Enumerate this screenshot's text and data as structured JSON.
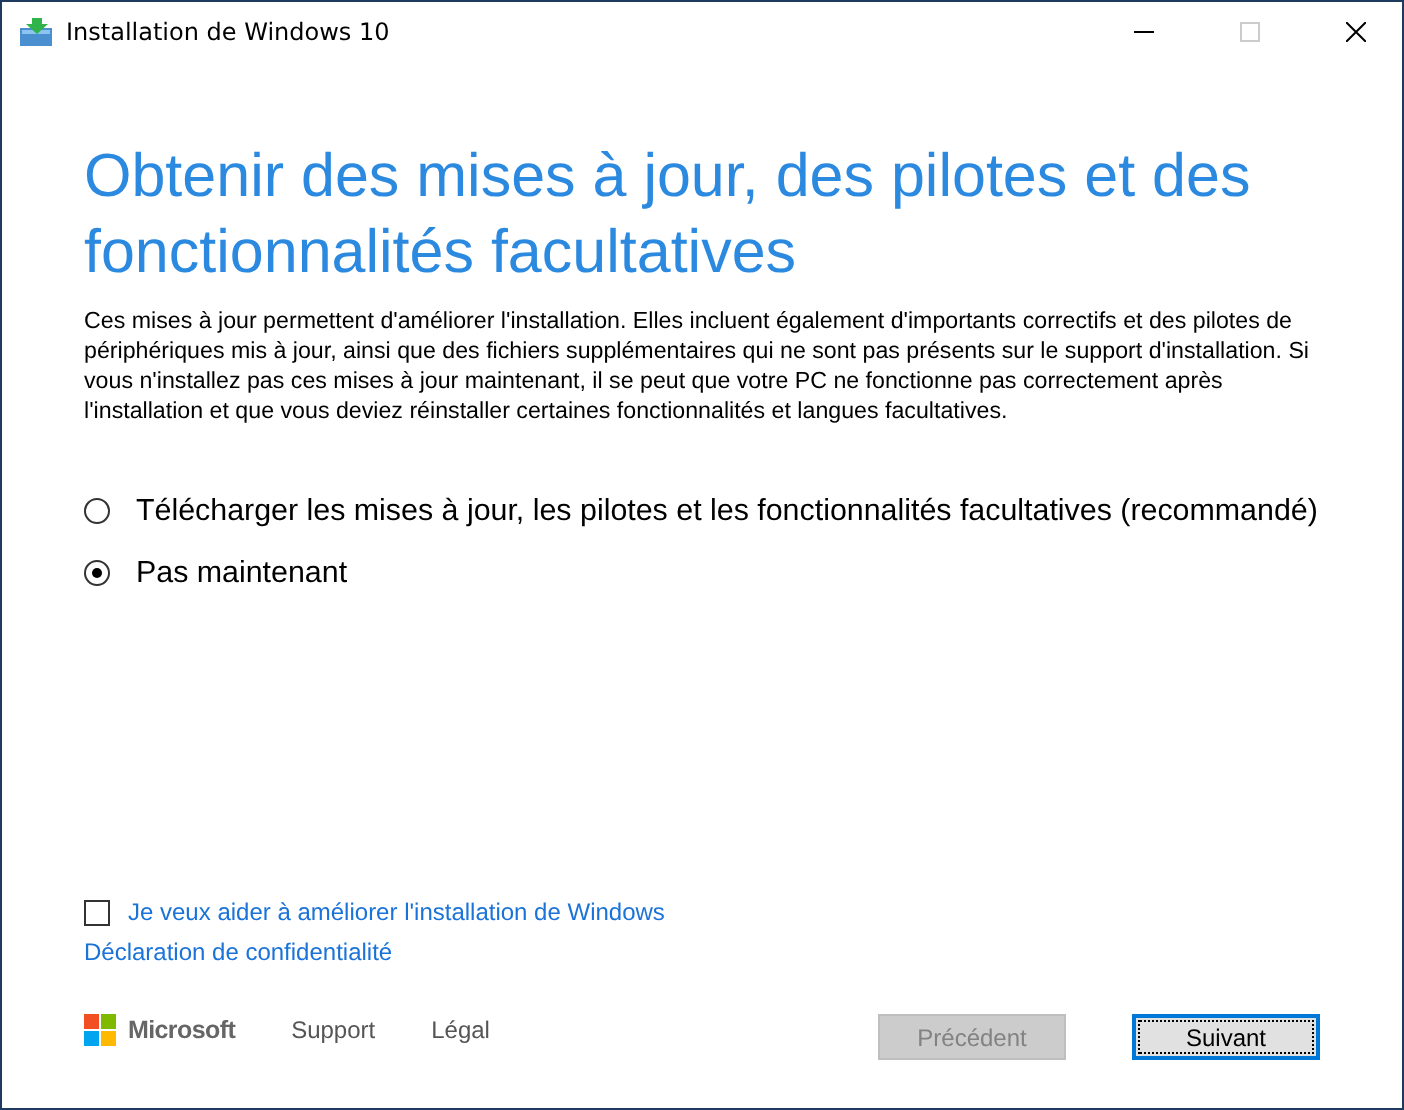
{
  "window": {
    "title": "Installation de Windows 10"
  },
  "heading": "Obtenir des mises à jour, des pilotes et des fonctionnalités facultatives",
  "description": "Ces mises à jour permettent d'améliorer l'installation. Elles incluent également d'importants correctifs et des pilotes de périphériques mis à jour, ainsi que des fichiers supplémentaires qui ne sont pas présents sur le support d'installation. Si vous n'installez pas ces mises à jour maintenant, il se peut que votre PC ne fonctionne pas correctement après l'installation et que vous deviez réinstaller certaines fonctionnalités et langues facultatives.",
  "options": [
    {
      "label": "Télécharger les mises à jour, les pilotes et les fonctionnalités facultatives (recommandé)",
      "selected": false
    },
    {
      "label": "Pas maintenant",
      "selected": true
    }
  ],
  "improve_checkbox": {
    "label": "Je veux aider à améliorer l'installation de Windows",
    "checked": false
  },
  "privacy_link": "Déclaration de confidentialité",
  "footer": {
    "brand": "Microsoft",
    "links": [
      "Support",
      "Légal"
    ]
  },
  "buttons": [
    {
      "label": "Précédent",
      "disabled": true,
      "focused": false
    },
    {
      "label": "Suivant",
      "disabled": false,
      "focused": true
    }
  ]
}
